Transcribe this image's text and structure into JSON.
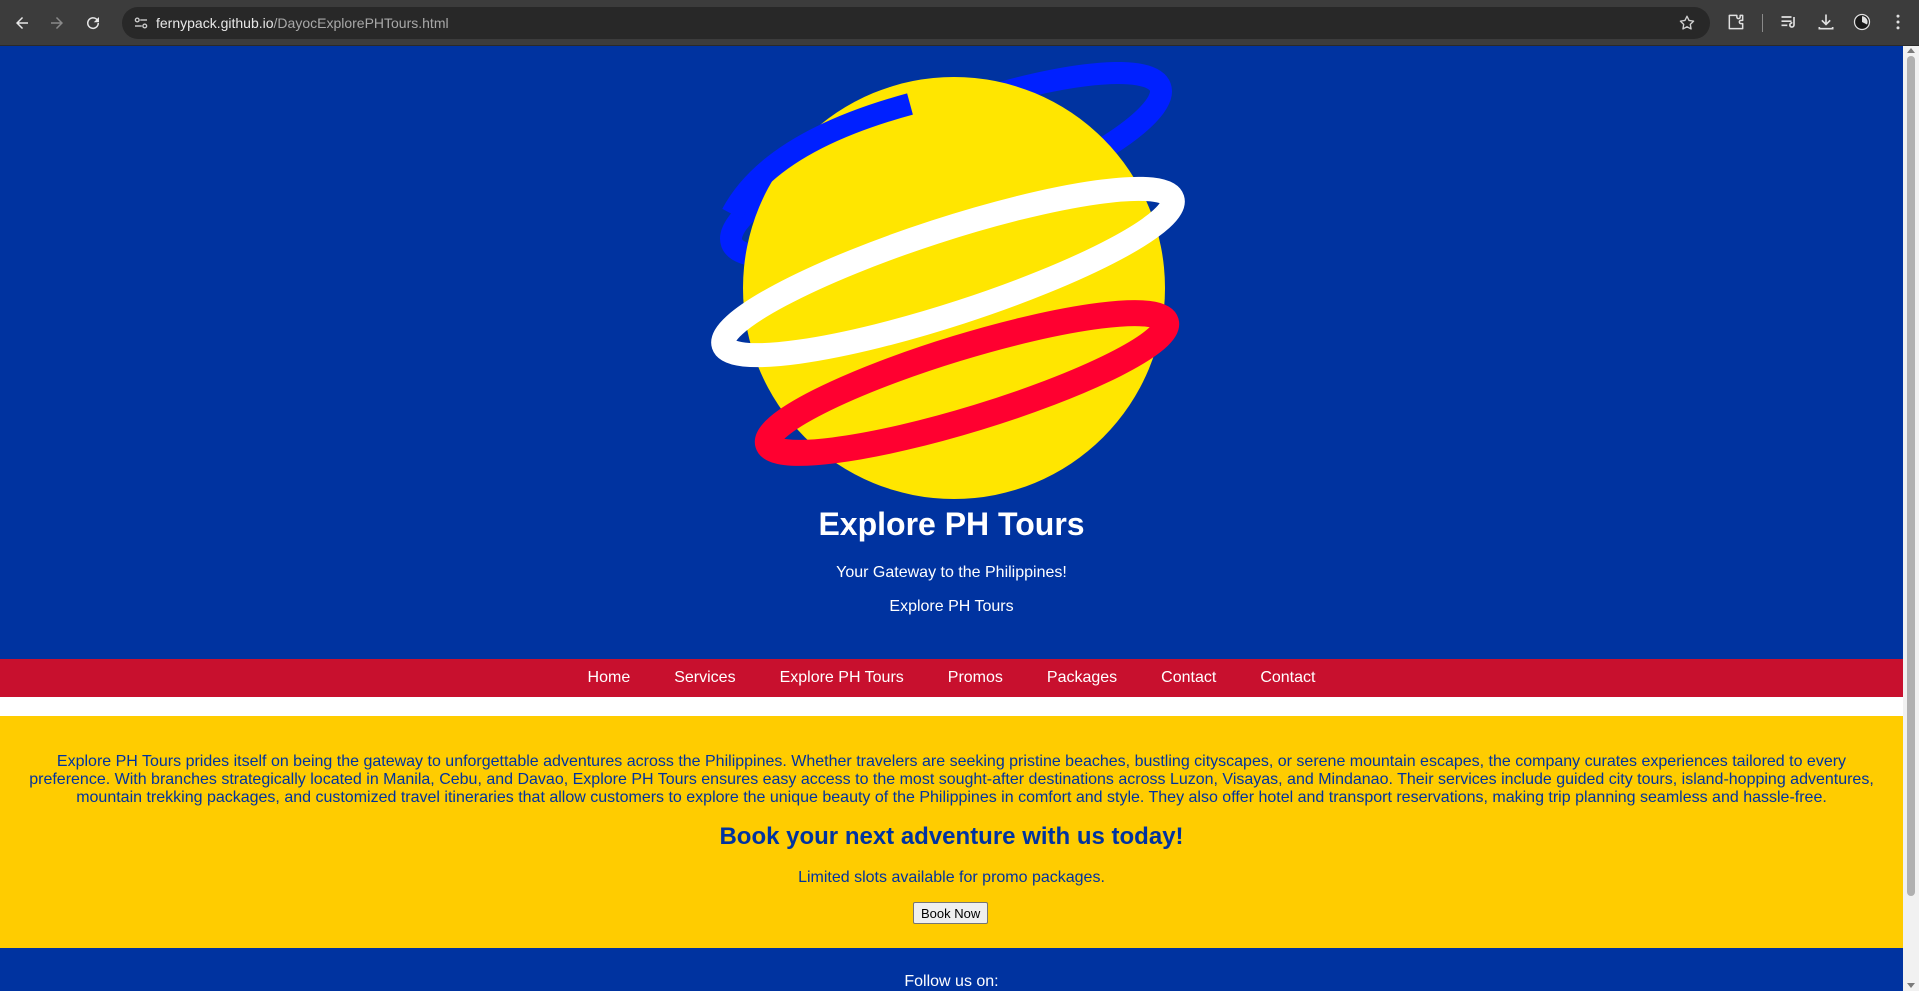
{
  "browser": {
    "url_host": "fernypack.github.io",
    "url_path": "/DayocExplorePHTours.html"
  },
  "hero": {
    "title": "Explore PH Tours",
    "tagline": "Your Gateway to the Philippines!",
    "subtitle": "Explore PH Tours",
    "colors": {
      "background": "#0033a0",
      "planet": "#ffe600",
      "ring_blue": "#0020ff",
      "ring_white": "#ffffff",
      "ring_red": "#ff0030"
    }
  },
  "nav": {
    "items": [
      "Home",
      "Services",
      "Explore PH Tours",
      "Promos",
      "Packages",
      "Contact",
      "Contact"
    ],
    "background": "#c8102e"
  },
  "about": {
    "text": "Explore PH Tours prides itself on being the gateway to unforgettable adventures across the Philippines. Whether travelers are seeking pristine beaches, bustling cityscapes, or serene mountain escapes, the company curates experiences tailored to every preference. With branches strategically located in Manila, Cebu, and Davao, Explore PH Tours ensures easy access to the most sought-after destinations across Luzon, Visayas, and Mindanao. Their services include guided city tours, island-hopping adventures, mountain trekking packages, and customized travel itineraries that allow customers to explore the unique beauty of the Philippines in comfort and style. They also offer hotel and transport reservations, making trip planning seamless and hassle-free.",
    "cta_title": "Book your next adventure with us today!",
    "cta_note": "Limited slots available for promo packages.",
    "button_label": "Book Now",
    "background": "#ffcc00"
  },
  "footer": {
    "follow": "Follow us on:"
  }
}
